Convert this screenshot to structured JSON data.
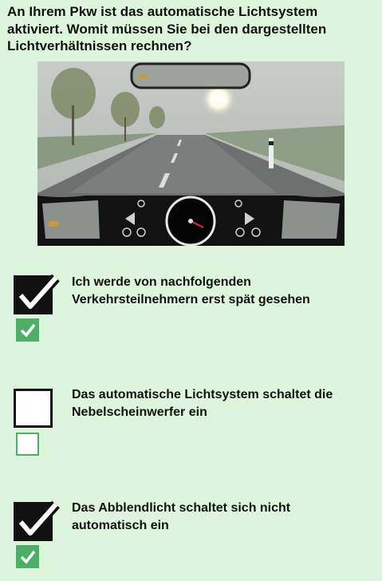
{
  "question": {
    "text": "An Ihrem Pkw ist das automatische Lichtsystem aktiviert. Womit müssen Sie bei den dargestellten Lichtverhältnissen rechnen?"
  },
  "answers": [
    {
      "text": "Ich werde von nachfolgenden Verkehrsteilnehmern erst spät gesehen",
      "selected": true,
      "correct": true
    },
    {
      "text": "Das automatische Lichtsystem schaltet die Nebelscheinwerfer ein",
      "selected": false,
      "correct": false
    },
    {
      "text": "Das Abblendlicht schaltet sich nicht automatisch ein",
      "selected": true,
      "correct": true
    }
  ],
  "colors": {
    "background": "#dcf5dc",
    "correct_green": "#4caf65",
    "checkbox_dark": "#111111"
  },
  "icons": [
    "check-icon",
    "speedometer-icon",
    "turn-signal-left-icon",
    "turn-signal-right-icon",
    "headlight-icon",
    "fog-light-icon"
  ]
}
